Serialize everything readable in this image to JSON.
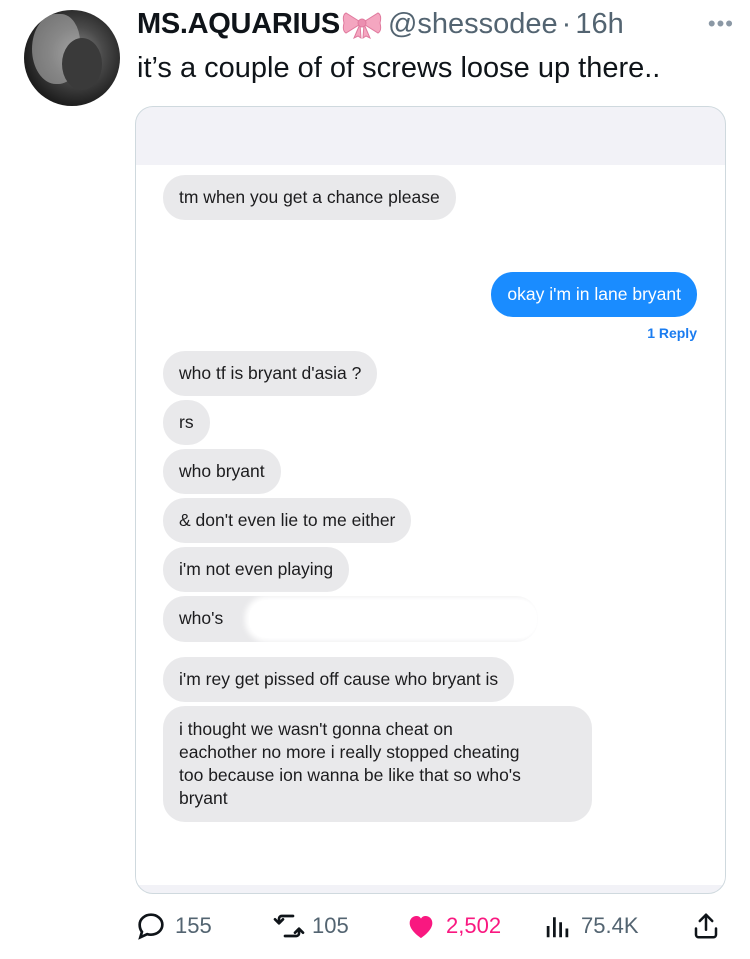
{
  "tweet": {
    "display_name": "MS.AQUARIUS",
    "handle": "@shessodee",
    "separator": "·",
    "time": "16h",
    "more_icon": "ellipsis-icon",
    "text": "it’s a couple of of screws loose up there.."
  },
  "messages": [
    {
      "side": "received",
      "text": "tm when you get a chance please"
    },
    {
      "side": "sent",
      "text": "okay i'm in lane bryant"
    },
    {
      "side": "received",
      "text": "who tf is bryant d'asia ?"
    },
    {
      "side": "received",
      "text": "rs"
    },
    {
      "side": "received",
      "text": "who bryant"
    },
    {
      "side": "received",
      "text": "& don't even lie to me either"
    },
    {
      "side": "received",
      "text": "i'm not even playing"
    },
    {
      "side": "received",
      "text": "who's"
    },
    {
      "side": "received",
      "text": "i'm rey get pissed off cause who bryant is"
    },
    {
      "side": "received",
      "text": "i thought we wasn't gonna cheat on eachother no more i really stopped cheating too because ion wanna be like that so who's bryant"
    }
  ],
  "message_lines": {
    "long": [
      "i thought we wasn't gonna cheat on",
      "eachother no more i really stopped cheating",
      "too because ion wanna be like that so who's",
      "bryant"
    ]
  },
  "reply_label": "1 Reply",
  "actions": {
    "replies": "155",
    "retweets": "105",
    "likes": "2,502",
    "views": "75.4K"
  },
  "colors": {
    "like": "#f91880",
    "sent_bubble": "#1a8cff",
    "received_bubble": "#e9e9eb"
  }
}
